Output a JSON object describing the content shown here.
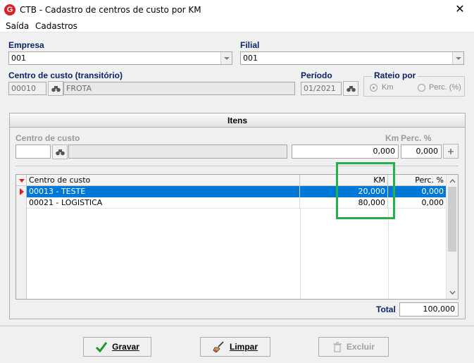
{
  "window": {
    "title": "CTB - Cadastro de centros de custo por KM",
    "icon_letter": "G",
    "close_glyph": "✕"
  },
  "menu": {
    "items": [
      "Saída",
      "Cadastros"
    ]
  },
  "empresa": {
    "label": "Empresa",
    "value": "001"
  },
  "filial": {
    "label": "Filial",
    "value": "001"
  },
  "centro": {
    "label": "Centro de custo (transitório)",
    "code": "00010",
    "name": "FROTA"
  },
  "periodo": {
    "label": "Período",
    "value": "01/2021"
  },
  "rateio": {
    "label": "Rateio por",
    "options": [
      "Km",
      "Perc. (%)"
    ],
    "selected": "Km"
  },
  "itens": {
    "title": "Itens",
    "cc_label": "Centro de custo",
    "km_label": "Km",
    "perc_label": "Perc. %",
    "km_value": "0,000",
    "perc_value": "0,000",
    "grid": {
      "columns": [
        "Centro de custo",
        "KM",
        "Perc. %"
      ],
      "rows": [
        {
          "cc": "00013 - TESTE",
          "km": "20,000",
          "perc": "0,000"
        },
        {
          "cc": "00021 - LOGISTICA",
          "km": "80,000",
          "perc": "0,000"
        }
      ]
    },
    "total_label": "Total",
    "total_value": "100,000"
  },
  "buttons": {
    "gravar": {
      "label": "Gravar"
    },
    "limpar": {
      "label": "Limpar"
    },
    "excluir": {
      "label": "Excluir"
    }
  },
  "colors": {
    "accent": "#0078d7",
    "label": "#0a246a",
    "highlight": "#22b14c",
    "brand": "#d8232a"
  }
}
